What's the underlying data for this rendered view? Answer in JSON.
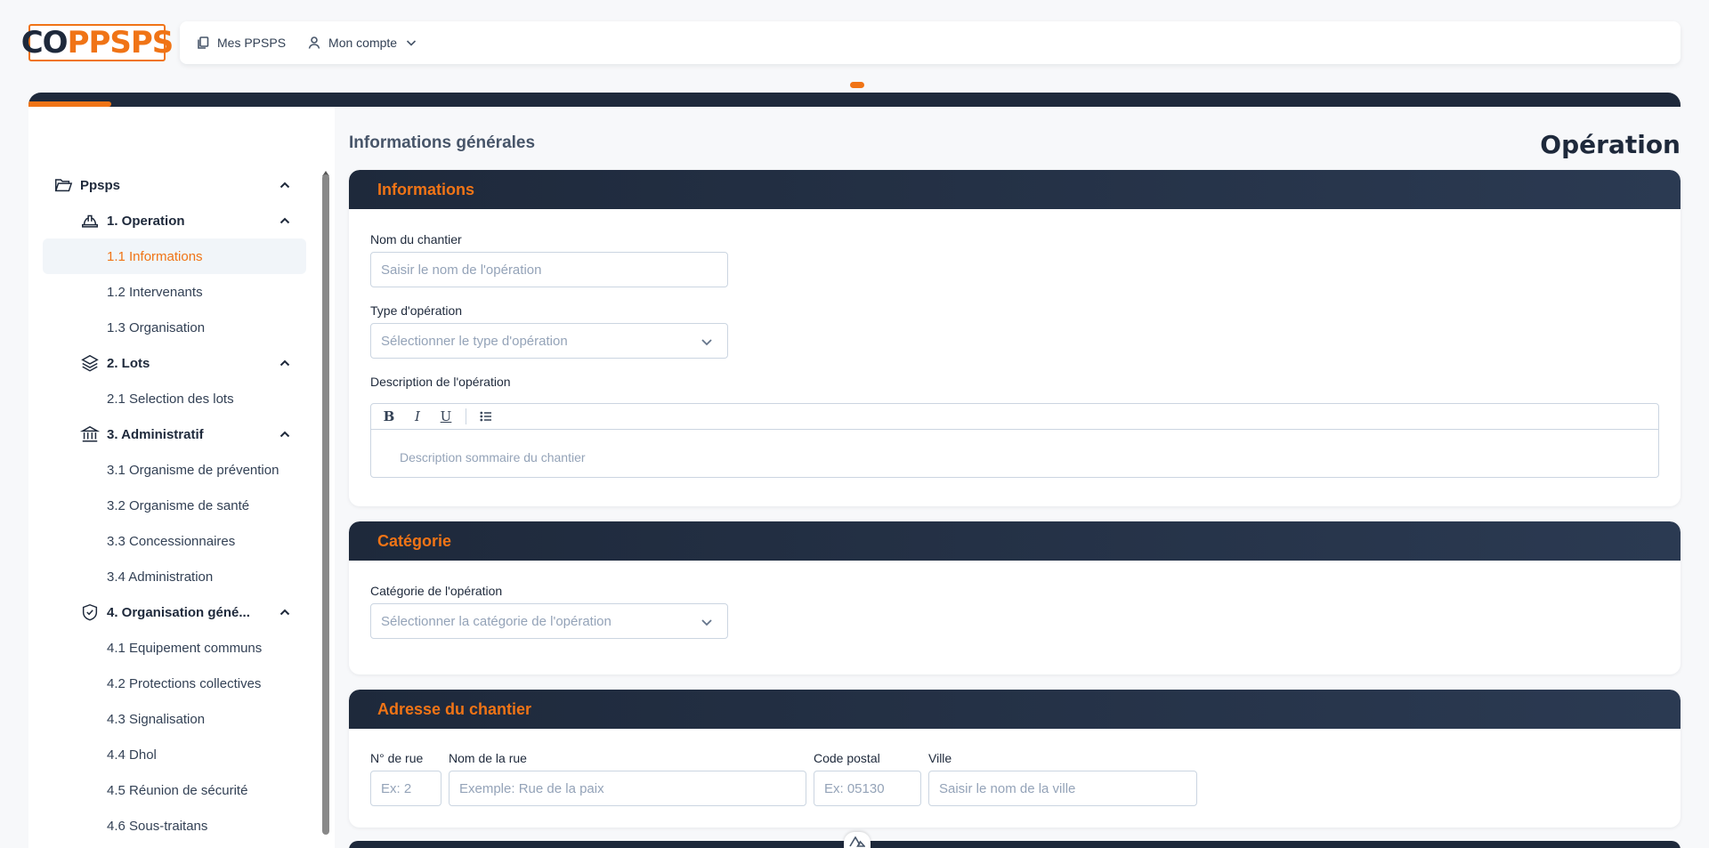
{
  "logo": {
    "part1": "CO",
    "part2": "PPSPS"
  },
  "topnav": {
    "mes_ppsps": "Mes PPSPS",
    "mon_compte": "Mon compte"
  },
  "progress": {
    "fraction": 0.05
  },
  "colors": {
    "accent": "#f07416",
    "navy": "#1e293b"
  },
  "sidebar": {
    "root": {
      "label": "Ppsps",
      "icon": "folder-open-icon"
    },
    "groups": [
      {
        "label": "1. Operation",
        "icon": "hard-hat-icon",
        "items": [
          "1.1 Informations",
          "1.2 Intervenants",
          "1.3 Organisation"
        ]
      },
      {
        "label": "2. Lots",
        "icon": "layers-icon",
        "items": [
          "2.1 Selection des lots"
        ]
      },
      {
        "label": "3. Administratif",
        "icon": "bank-icon",
        "items": [
          "3.1 Organisme de prévention",
          "3.2 Organisme de santé",
          "3.3 Concessionnaires",
          "3.4 Administration"
        ]
      },
      {
        "label": "4. Organisation géné...",
        "icon": "shield-check-icon",
        "items": [
          "4.1 Equipement communs",
          "4.2 Protections collectives",
          "4.3 Signalisation",
          "4.4 Dhol",
          "4.5 Réunion de sécurité",
          "4.6 Sous-traitans"
        ]
      }
    ],
    "active_item": "1.1 Informations"
  },
  "main": {
    "section_heading": "Informations générales",
    "page_title": "Opération",
    "informations": {
      "title": "Informations",
      "nom_label": "Nom du chantier",
      "nom_placeholder": "Saisir le nom de l'opération",
      "type_label": "Type d'opération",
      "type_placeholder": "Sélectionner le type d'opération",
      "desc_label": "Description de l'opération",
      "desc_placeholder": "Description sommaire du chantier",
      "toolbar": {
        "bold": "B",
        "italic": "I",
        "underline": "U"
      }
    },
    "categorie": {
      "title": "Catégorie",
      "label": "Catégorie de l'opération",
      "placeholder": "Sélectionner la catégorie de l'opération"
    },
    "adresse": {
      "title": "Adresse du chantier",
      "num_label": "N° de rue",
      "num_placeholder": "Ex: 2",
      "rue_label": "Nom de la rue",
      "rue_placeholder": "Exemple: Rue de la paix",
      "cp_label": "Code postal",
      "cp_placeholder": "Ex: 05130",
      "ville_label": "Ville",
      "ville_placeholder": "Saisir le nom de la ville"
    }
  }
}
